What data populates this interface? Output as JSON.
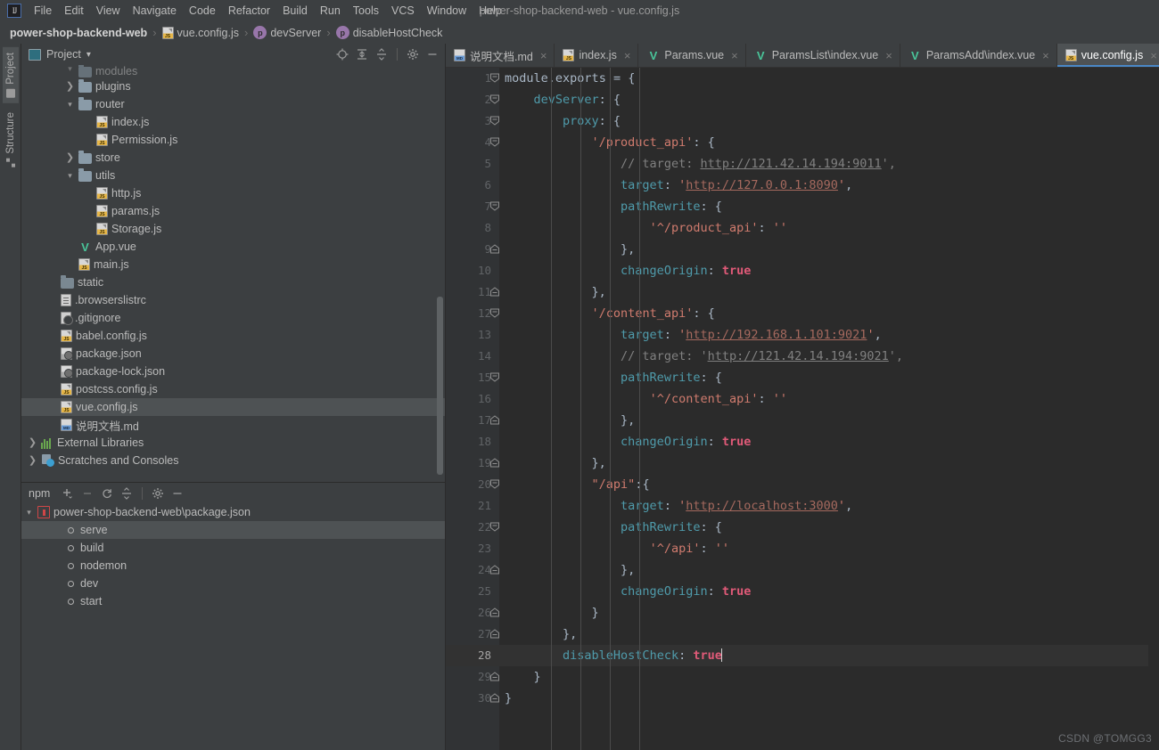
{
  "window": {
    "title": "power-shop-backend-web - vue.config.js",
    "logo": "intellij-logo"
  },
  "menubar": {
    "items": [
      {
        "label": "File"
      },
      {
        "label": "Edit"
      },
      {
        "label": "View"
      },
      {
        "label": "Navigate"
      },
      {
        "label": "Code"
      },
      {
        "label": "Refactor"
      },
      {
        "label": "Build"
      },
      {
        "label": "Run"
      },
      {
        "label": "Tools"
      },
      {
        "label": "VCS"
      },
      {
        "label": "Window"
      },
      {
        "label": "Help"
      }
    ]
  },
  "breadcrumb": {
    "items": [
      {
        "label": "power-shop-backend-web",
        "icon": "none"
      },
      {
        "label": "vue.config.js",
        "icon": "js-file-icon"
      },
      {
        "label": "devServer",
        "icon": "property-icon"
      },
      {
        "label": "disableHostCheck",
        "icon": "property-icon"
      }
    ],
    "separator": "›"
  },
  "tool_strip": {
    "tabs": [
      {
        "label": "Project",
        "icon": "project-icon",
        "active": true
      },
      {
        "label": "Structure",
        "icon": "structure-icon",
        "active": false
      }
    ]
  },
  "project_panel": {
    "title": "Project",
    "dropdown_caret": "▾",
    "toolbar_icons": [
      "locate-icon",
      "expand-all-icon",
      "collapse-all-icon",
      "gear-icon",
      "hide-icon"
    ],
    "tree": [
      {
        "label": "modules",
        "indent": 1,
        "arrow": "⌄",
        "icon": "folder-icon",
        "clipped": true,
        "selected": false
      },
      {
        "label": "plugins",
        "indent": 1,
        "arrow": "›",
        "icon": "folder-icon",
        "selected": false
      },
      {
        "label": "router",
        "indent": 1,
        "arrow": "⌄",
        "icon": "folder-icon",
        "selected": false
      },
      {
        "label": "index.js",
        "indent": 2,
        "arrow": "",
        "icon": "js-file-icon",
        "selected": false
      },
      {
        "label": "Permission.js",
        "indent": 2,
        "arrow": "",
        "icon": "js-file-icon",
        "selected": false
      },
      {
        "label": "store",
        "indent": 1,
        "arrow": "›",
        "icon": "folder-icon",
        "selected": false
      },
      {
        "label": "utils",
        "indent": 1,
        "arrow": "⌄",
        "icon": "folder-icon",
        "selected": false
      },
      {
        "label": "http.js",
        "indent": 2,
        "arrow": "",
        "icon": "js-file-icon",
        "selected": false
      },
      {
        "label": "params.js",
        "indent": 2,
        "arrow": "",
        "icon": "js-file-icon",
        "selected": false
      },
      {
        "label": "Storage.js",
        "indent": 2,
        "arrow": "",
        "icon": "js-file-icon",
        "selected": false
      },
      {
        "label": "App.vue",
        "indent": 1,
        "arrow": "",
        "icon": "vue-file-icon",
        "selected": false
      },
      {
        "label": "main.js",
        "indent": 1,
        "arrow": "",
        "icon": "js-file-icon",
        "selected": false
      },
      {
        "label": "static",
        "indent": 0,
        "arrow": "",
        "icon": "folder-icon-dark",
        "selected": false
      },
      {
        "label": ".browserslistrc",
        "indent": 0,
        "arrow": "",
        "icon": "text-file-icon",
        "selected": false
      },
      {
        "label": ".gitignore",
        "indent": 0,
        "arrow": "",
        "icon": "gitignore-icon",
        "selected": false
      },
      {
        "label": "babel.config.js",
        "indent": 0,
        "arrow": "",
        "icon": "js-file-icon",
        "selected": false
      },
      {
        "label": "package.json",
        "indent": 0,
        "arrow": "",
        "icon": "json-file-icon",
        "selected": false
      },
      {
        "label": "package-lock.json",
        "indent": 0,
        "arrow": "",
        "icon": "json-file-icon",
        "selected": false
      },
      {
        "label": "postcss.config.js",
        "indent": 0,
        "arrow": "",
        "icon": "js-file-icon",
        "selected": false
      },
      {
        "label": "vue.config.js",
        "indent": 0,
        "arrow": "",
        "icon": "js-file-icon",
        "selected": true
      },
      {
        "label": "说明文档.md",
        "indent": 0,
        "arrow": "",
        "icon": "md-file-icon",
        "selected": false
      },
      {
        "label": "External Libraries",
        "indent": -1,
        "arrow": "›",
        "icon": "libraries-icon",
        "selected": false
      },
      {
        "label": "Scratches and Consoles",
        "indent": -1,
        "arrow": "›",
        "icon": "scratches-icon",
        "selected": false
      }
    ]
  },
  "npm_panel": {
    "title": "npm",
    "toolbar_icons": [
      "add-icon",
      "remove-icon",
      "refresh-icon",
      "collapse-all-icon",
      "gear-icon",
      "hide-icon"
    ],
    "tree": [
      {
        "label": "power-shop-backend-web\\package.json",
        "indent": 0,
        "arrow": "⌄",
        "icon": "npm-icon",
        "selected": false
      },
      {
        "label": "serve",
        "indent": 1,
        "arrow": "",
        "icon": "script-icon",
        "selected": true
      },
      {
        "label": "build",
        "indent": 1,
        "arrow": "",
        "icon": "script-icon",
        "selected": false
      },
      {
        "label": "nodemon",
        "indent": 1,
        "arrow": "",
        "icon": "script-icon",
        "selected": false
      },
      {
        "label": "dev",
        "indent": 1,
        "arrow": "",
        "icon": "script-icon",
        "selected": false
      },
      {
        "label": "start",
        "indent": 1,
        "arrow": "",
        "icon": "script-icon",
        "selected": false
      }
    ]
  },
  "editor": {
    "tabs": [
      {
        "label": "说明文档.md",
        "icon": "md-file-icon",
        "active": false,
        "closable": true
      },
      {
        "label": "index.js",
        "icon": "js-file-icon",
        "active": false,
        "closable": true
      },
      {
        "label": "Params.vue",
        "icon": "vue-file-icon",
        "active": false,
        "closable": true
      },
      {
        "label": "ParamsList\\index.vue",
        "icon": "vue-file-icon",
        "active": false,
        "closable": true
      },
      {
        "label": "ParamsAdd\\index.vue",
        "icon": "vue-file-icon",
        "active": false,
        "closable": true
      },
      {
        "label": "vue.config.js",
        "icon": "js-file-icon",
        "active": true,
        "closable": true
      }
    ],
    "close_glyph": "×",
    "current_line": 28,
    "lines": [
      {
        "n": 1,
        "fold": "open",
        "tokens": [
          [
            "t-ident",
            "module"
          ],
          [
            "t-white",
            "."
          ],
          [
            "t-ident",
            "exports"
          ],
          [
            "t-white",
            " = {"
          ]
        ]
      },
      {
        "n": 2,
        "fold": "open",
        "tokens": [
          [
            "t-white",
            "    "
          ],
          [
            "t-teal",
            "devServer"
          ],
          [
            "t-white",
            ": {"
          ]
        ]
      },
      {
        "n": 3,
        "fold": "open",
        "tokens": [
          [
            "t-white",
            "        "
          ],
          [
            "t-teal",
            "proxy"
          ],
          [
            "t-white",
            ": {"
          ]
        ]
      },
      {
        "n": 4,
        "fold": "open",
        "tokens": [
          [
            "t-white",
            "            "
          ],
          [
            "t-salmon",
            "'/product_api'"
          ],
          [
            "t-white",
            ": {"
          ]
        ]
      },
      {
        "n": 5,
        "fold": "",
        "tokens": [
          [
            "t-white",
            "                "
          ],
          [
            "t-cmt",
            "// target: "
          ],
          [
            "t-cmt-url",
            "http://121.42.14.194:9011"
          ],
          [
            "t-cmt",
            "',"
          ]
        ],
        "comment_prefix": "// target: '"
      },
      {
        "n": 6,
        "fold": "",
        "tokens": [
          [
            "t-white",
            "                "
          ],
          [
            "t-teal",
            "target"
          ],
          [
            "t-white",
            ": "
          ],
          [
            "t-salmon",
            "'"
          ],
          [
            "t-url",
            "http://127.0.0.1:8090"
          ],
          [
            "t-salmon",
            "'"
          ],
          [
            "t-white",
            ","
          ]
        ]
      },
      {
        "n": 7,
        "fold": "open",
        "tokens": [
          [
            "t-white",
            "                "
          ],
          [
            "t-teal",
            "pathRewrite"
          ],
          [
            "t-white",
            ": {"
          ]
        ]
      },
      {
        "n": 8,
        "fold": "",
        "tokens": [
          [
            "t-white",
            "                    "
          ],
          [
            "t-salmon",
            "'^/product_api'"
          ],
          [
            "t-white",
            ": "
          ],
          [
            "t-salmon",
            "''"
          ]
        ]
      },
      {
        "n": 9,
        "fold": "close",
        "tokens": [
          [
            "t-white",
            "                },"
          ]
        ]
      },
      {
        "n": 10,
        "fold": "",
        "tokens": [
          [
            "t-white",
            "                "
          ],
          [
            "t-teal",
            "changeOrigin"
          ],
          [
            "t-white",
            ": "
          ],
          [
            "t-pink",
            "true"
          ]
        ]
      },
      {
        "n": 11,
        "fold": "close",
        "tokens": [
          [
            "t-white",
            "            },"
          ]
        ]
      },
      {
        "n": 12,
        "fold": "open",
        "tokens": [
          [
            "t-white",
            "            "
          ],
          [
            "t-salmon",
            "'/content_api'"
          ],
          [
            "t-white",
            ": {"
          ]
        ]
      },
      {
        "n": 13,
        "fold": "",
        "tokens": [
          [
            "t-white",
            "                "
          ],
          [
            "t-teal",
            "target"
          ],
          [
            "t-white",
            ": "
          ],
          [
            "t-salmon",
            "'"
          ],
          [
            "t-url",
            "http://192.168.1.101:9021"
          ],
          [
            "t-salmon",
            "'"
          ],
          [
            "t-white",
            ","
          ]
        ]
      },
      {
        "n": 14,
        "fold": "",
        "tokens": [
          [
            "t-white",
            "                "
          ],
          [
            "t-cmt",
            "// target: '"
          ],
          [
            "t-cmt-url",
            "http://121.42.14.194:9021"
          ],
          [
            "t-cmt",
            "',"
          ]
        ]
      },
      {
        "n": 15,
        "fold": "open",
        "tokens": [
          [
            "t-white",
            "                "
          ],
          [
            "t-teal",
            "pathRewrite"
          ],
          [
            "t-white",
            ": {"
          ]
        ]
      },
      {
        "n": 16,
        "fold": "",
        "tokens": [
          [
            "t-white",
            "                    "
          ],
          [
            "t-salmon",
            "'^/content_api'"
          ],
          [
            "t-white",
            ": "
          ],
          [
            "t-salmon",
            "''"
          ]
        ]
      },
      {
        "n": 17,
        "fold": "close",
        "tokens": [
          [
            "t-white",
            "                },"
          ]
        ]
      },
      {
        "n": 18,
        "fold": "",
        "tokens": [
          [
            "t-white",
            "                "
          ],
          [
            "t-teal",
            "changeOrigin"
          ],
          [
            "t-white",
            ": "
          ],
          [
            "t-pink",
            "true"
          ]
        ]
      },
      {
        "n": 19,
        "fold": "close",
        "tokens": [
          [
            "t-white",
            "            },"
          ]
        ]
      },
      {
        "n": 20,
        "fold": "open",
        "tokens": [
          [
            "t-white",
            "            "
          ],
          [
            "t-salmon",
            "\"/api\""
          ],
          [
            "t-white",
            ":{"
          ]
        ]
      },
      {
        "n": 21,
        "fold": "",
        "tokens": [
          [
            "t-white",
            "                "
          ],
          [
            "t-teal",
            "target"
          ],
          [
            "t-white",
            ": "
          ],
          [
            "t-salmon",
            "'"
          ],
          [
            "t-url",
            "http://localhost:3000"
          ],
          [
            "t-salmon",
            "'"
          ],
          [
            "t-white",
            ","
          ]
        ]
      },
      {
        "n": 22,
        "fold": "open",
        "tokens": [
          [
            "t-white",
            "                "
          ],
          [
            "t-teal",
            "pathRewrite"
          ],
          [
            "t-white",
            ": {"
          ]
        ]
      },
      {
        "n": 23,
        "fold": "",
        "tokens": [
          [
            "t-white",
            "                    "
          ],
          [
            "t-salmon",
            "'^/api'"
          ],
          [
            "t-white",
            ": "
          ],
          [
            "t-salmon",
            "''"
          ]
        ]
      },
      {
        "n": 24,
        "fold": "close",
        "tokens": [
          [
            "t-white",
            "                },"
          ]
        ]
      },
      {
        "n": 25,
        "fold": "",
        "tokens": [
          [
            "t-white",
            "                "
          ],
          [
            "t-teal",
            "changeOrigin"
          ],
          [
            "t-white",
            ": "
          ],
          [
            "t-pink",
            "true"
          ]
        ]
      },
      {
        "n": 26,
        "fold": "close",
        "tokens": [
          [
            "t-white",
            "            }"
          ]
        ]
      },
      {
        "n": 27,
        "fold": "close",
        "tokens": [
          [
            "t-white",
            "        },"
          ]
        ]
      },
      {
        "n": 28,
        "fold": "",
        "tokens": [
          [
            "t-white",
            "        "
          ],
          [
            "t-teal",
            "disableHostCheck"
          ],
          [
            "t-white",
            ": "
          ],
          [
            "t-pink",
            "true"
          ],
          [
            "caret",
            ""
          ]
        ]
      },
      {
        "n": 29,
        "fold": "close",
        "tokens": [
          [
            "t-white",
            "    }"
          ]
        ]
      },
      {
        "n": 30,
        "fold": "close",
        "tokens": [
          [
            "t-white",
            "}"
          ]
        ]
      }
    ]
  },
  "watermark": "CSDN @TOMGG3",
  "colors": {
    "bg_panel": "#3c3f41",
    "bg_editor": "#2b2b2b",
    "bg_gutter": "#313335",
    "selection": "#4e5254",
    "accent_tab": "#4a88c7",
    "text": "#bbbbbb",
    "string": "#a5c261",
    "keyword": "#cc7832",
    "url": "#a5695e",
    "bool": "#e05a78",
    "property": "#4f9bab",
    "comment": "#808080"
  }
}
